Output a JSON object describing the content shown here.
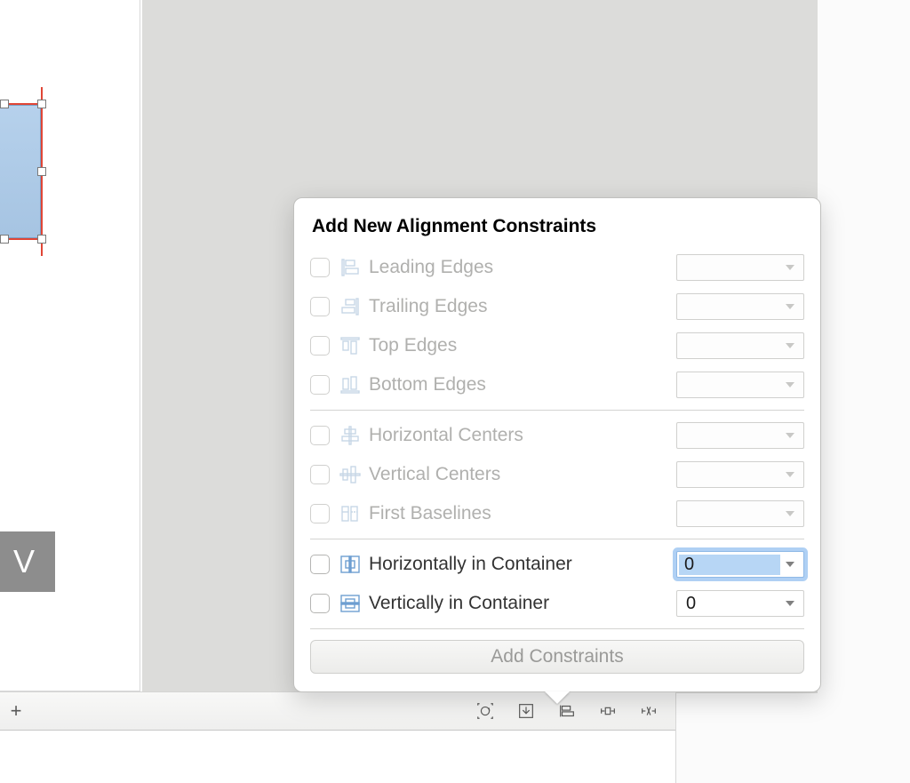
{
  "left": {
    "button_char": "V"
  },
  "bottombar": {
    "plus": "+"
  },
  "popover": {
    "title": "Add New Alignment Constraints",
    "rows": [
      {
        "label": "Leading Edges",
        "icon": "leading-edges-icon",
        "enabled": false,
        "value": ""
      },
      {
        "label": "Trailing Edges",
        "icon": "trailing-edges-icon",
        "enabled": false,
        "value": ""
      },
      {
        "label": "Top Edges",
        "icon": "top-edges-icon",
        "enabled": false,
        "value": ""
      },
      {
        "label": "Bottom Edges",
        "icon": "bottom-edges-icon",
        "enabled": false,
        "value": ""
      }
    ],
    "rows2": [
      {
        "label": "Horizontal Centers",
        "icon": "horizontal-centers-icon",
        "enabled": false,
        "value": ""
      },
      {
        "label": "Vertical Centers",
        "icon": "vertical-centers-icon",
        "enabled": false,
        "value": ""
      },
      {
        "label": "First Baselines",
        "icon": "first-baselines-icon",
        "enabled": false,
        "value": ""
      }
    ],
    "rows3": [
      {
        "label": "Horizontally in Container",
        "icon": "horizontally-in-container-icon",
        "enabled": true,
        "value": "0",
        "focused": true,
        "selected": true
      },
      {
        "label": "Vertically in Container",
        "icon": "vertically-in-container-icon",
        "enabled": true,
        "value": "0",
        "focused": false,
        "selected": false
      }
    ],
    "action": "Add Constraints"
  }
}
